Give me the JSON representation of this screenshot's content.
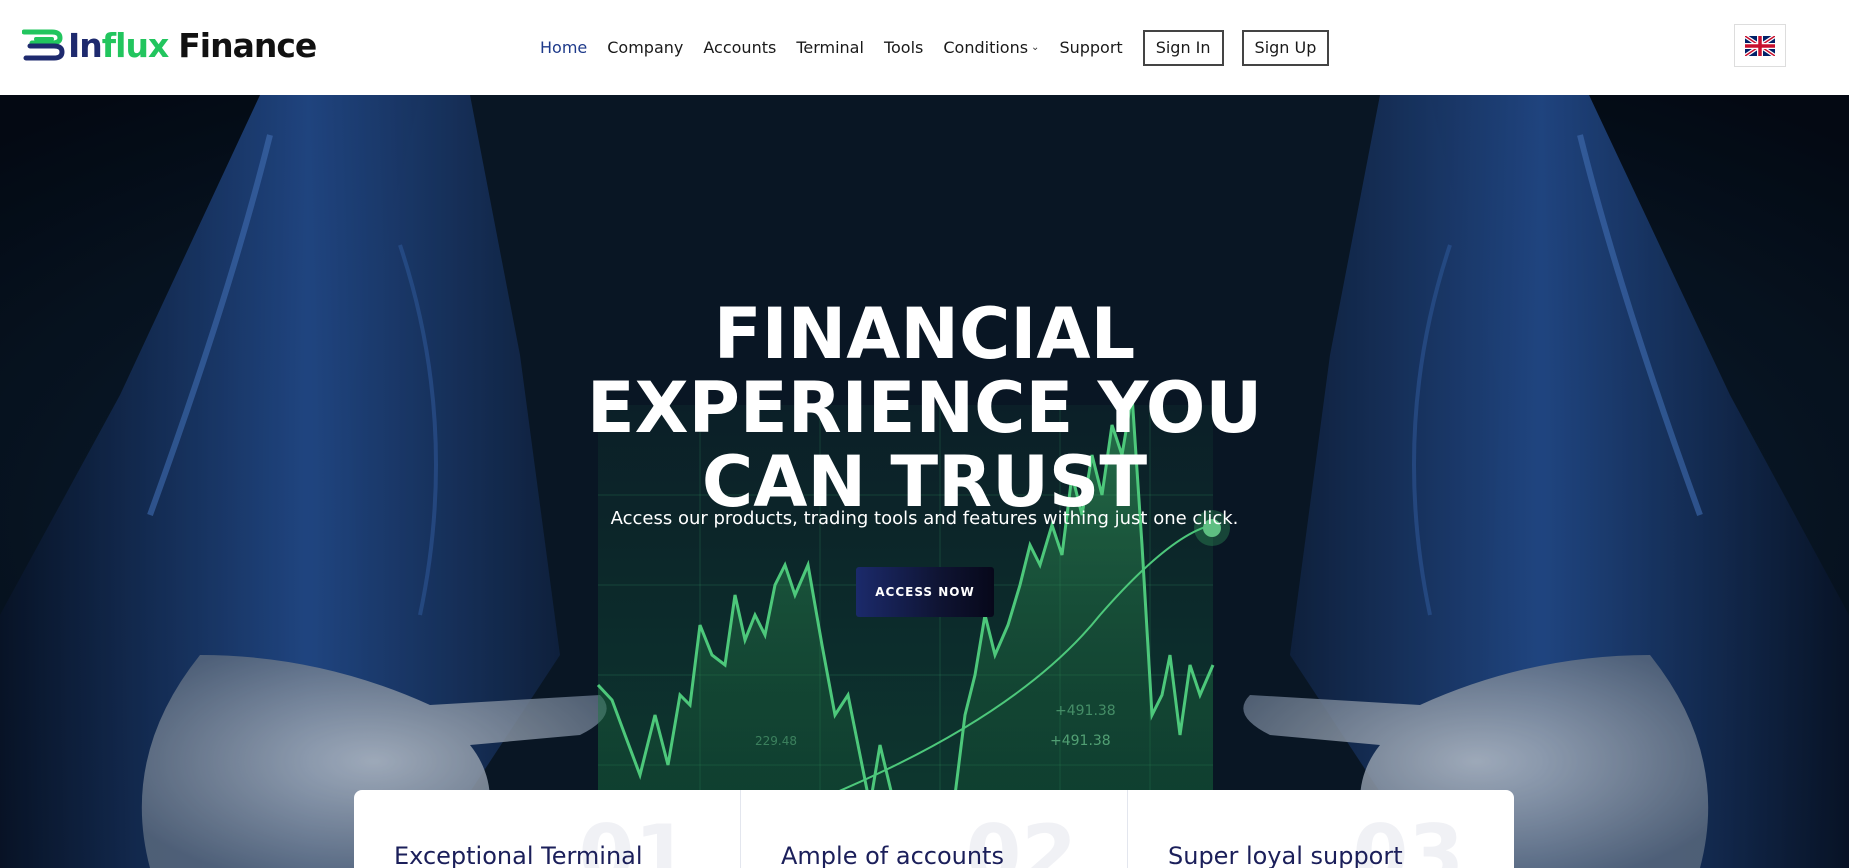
{
  "brand": {
    "name_part1": "Influx",
    "name_part2": "Finance",
    "colors": {
      "navy": "#1e2a6e",
      "green": "#22c55e"
    }
  },
  "nav": {
    "items": [
      {
        "label": "Home",
        "active": true
      },
      {
        "label": "Company",
        "active": false
      },
      {
        "label": "Accounts",
        "active": false
      },
      {
        "label": "Terminal",
        "active": false
      },
      {
        "label": "Tools",
        "active": false
      },
      {
        "label": "Conditions",
        "active": false,
        "has_dropdown": true
      },
      {
        "label": "Support",
        "active": false
      }
    ],
    "sign_in": "Sign In",
    "sign_up": "Sign Up",
    "language_icon": "uk-flag-icon"
  },
  "hero": {
    "title_lines": [
      "FINANCIAL",
      "EXPERIENCE YOU",
      "CAN TRUST"
    ],
    "subtitle": "Access our products, trading tools and features withing just one click.",
    "cta": "ACCESS NOW",
    "chart_labels": [
      "+491.38",
      "+491.38",
      "229.48"
    ]
  },
  "features": [
    {
      "title": "Exceptional Terminal",
      "number": "01"
    },
    {
      "title": "Ample of accounts",
      "number": "02"
    },
    {
      "title": "Super loyal support",
      "number": "03"
    }
  ]
}
